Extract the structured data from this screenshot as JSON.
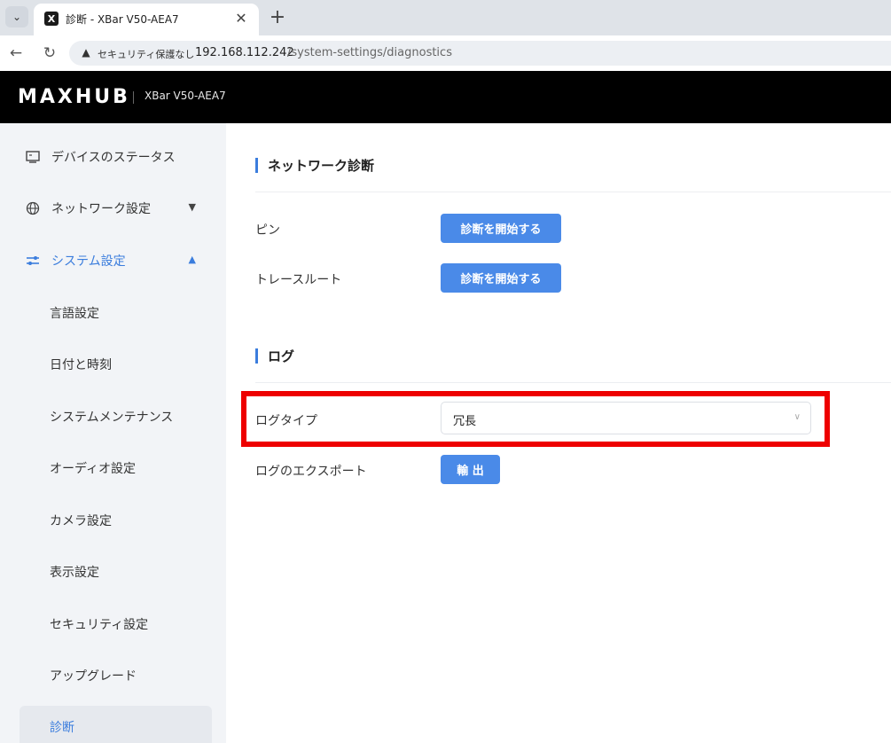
{
  "browser": {
    "tab_title": "診断 - XBar V50-AEA7",
    "tab_favicon": "X",
    "security_label": "セキュリティ保護なし",
    "url_host": "192.168.112.242",
    "url_path": "/system-settings/diagnostics"
  },
  "header": {
    "brand": "MAXHUB",
    "device_name": "XBar V50-AEA7"
  },
  "sidebar": {
    "items": [
      {
        "label": "デバイスのステータス",
        "icon": "monitor-icon"
      },
      {
        "label": "ネットワーク設定",
        "icon": "globe-icon",
        "chevron": "chevron-down-icon"
      },
      {
        "label": "システム設定",
        "icon": "sliders-icon",
        "chevron": "chevron-up-icon",
        "active": true
      }
    ],
    "subitems": [
      {
        "label": "言語設定"
      },
      {
        "label": "日付と時刻"
      },
      {
        "label": "システムメンテナンス"
      },
      {
        "label": "オーディオ設定"
      },
      {
        "label": "カメラ設定"
      },
      {
        "label": "表示設定"
      },
      {
        "label": "セキュリティ設定"
      },
      {
        "label": "アップグレード"
      },
      {
        "label": "診断",
        "selected": true
      }
    ]
  },
  "main": {
    "network_section": {
      "title": "ネットワーク診断",
      "ping_label": "ピン",
      "ping_button": "診断を開始する",
      "traceroute_label": "トレースルート",
      "traceroute_button": "診断を開始する"
    },
    "log_section": {
      "title": "ログ",
      "log_type_label": "ログタイプ",
      "log_type_value": "冗長",
      "export_label": "ログのエクスポート",
      "export_button": "輸 出"
    }
  },
  "colors": {
    "accent": "#3b7ddd",
    "button": "#4a8ae8",
    "header_bg": "#000000",
    "sidebar_bg": "#f2f4f7",
    "highlight": "#ee0000"
  }
}
